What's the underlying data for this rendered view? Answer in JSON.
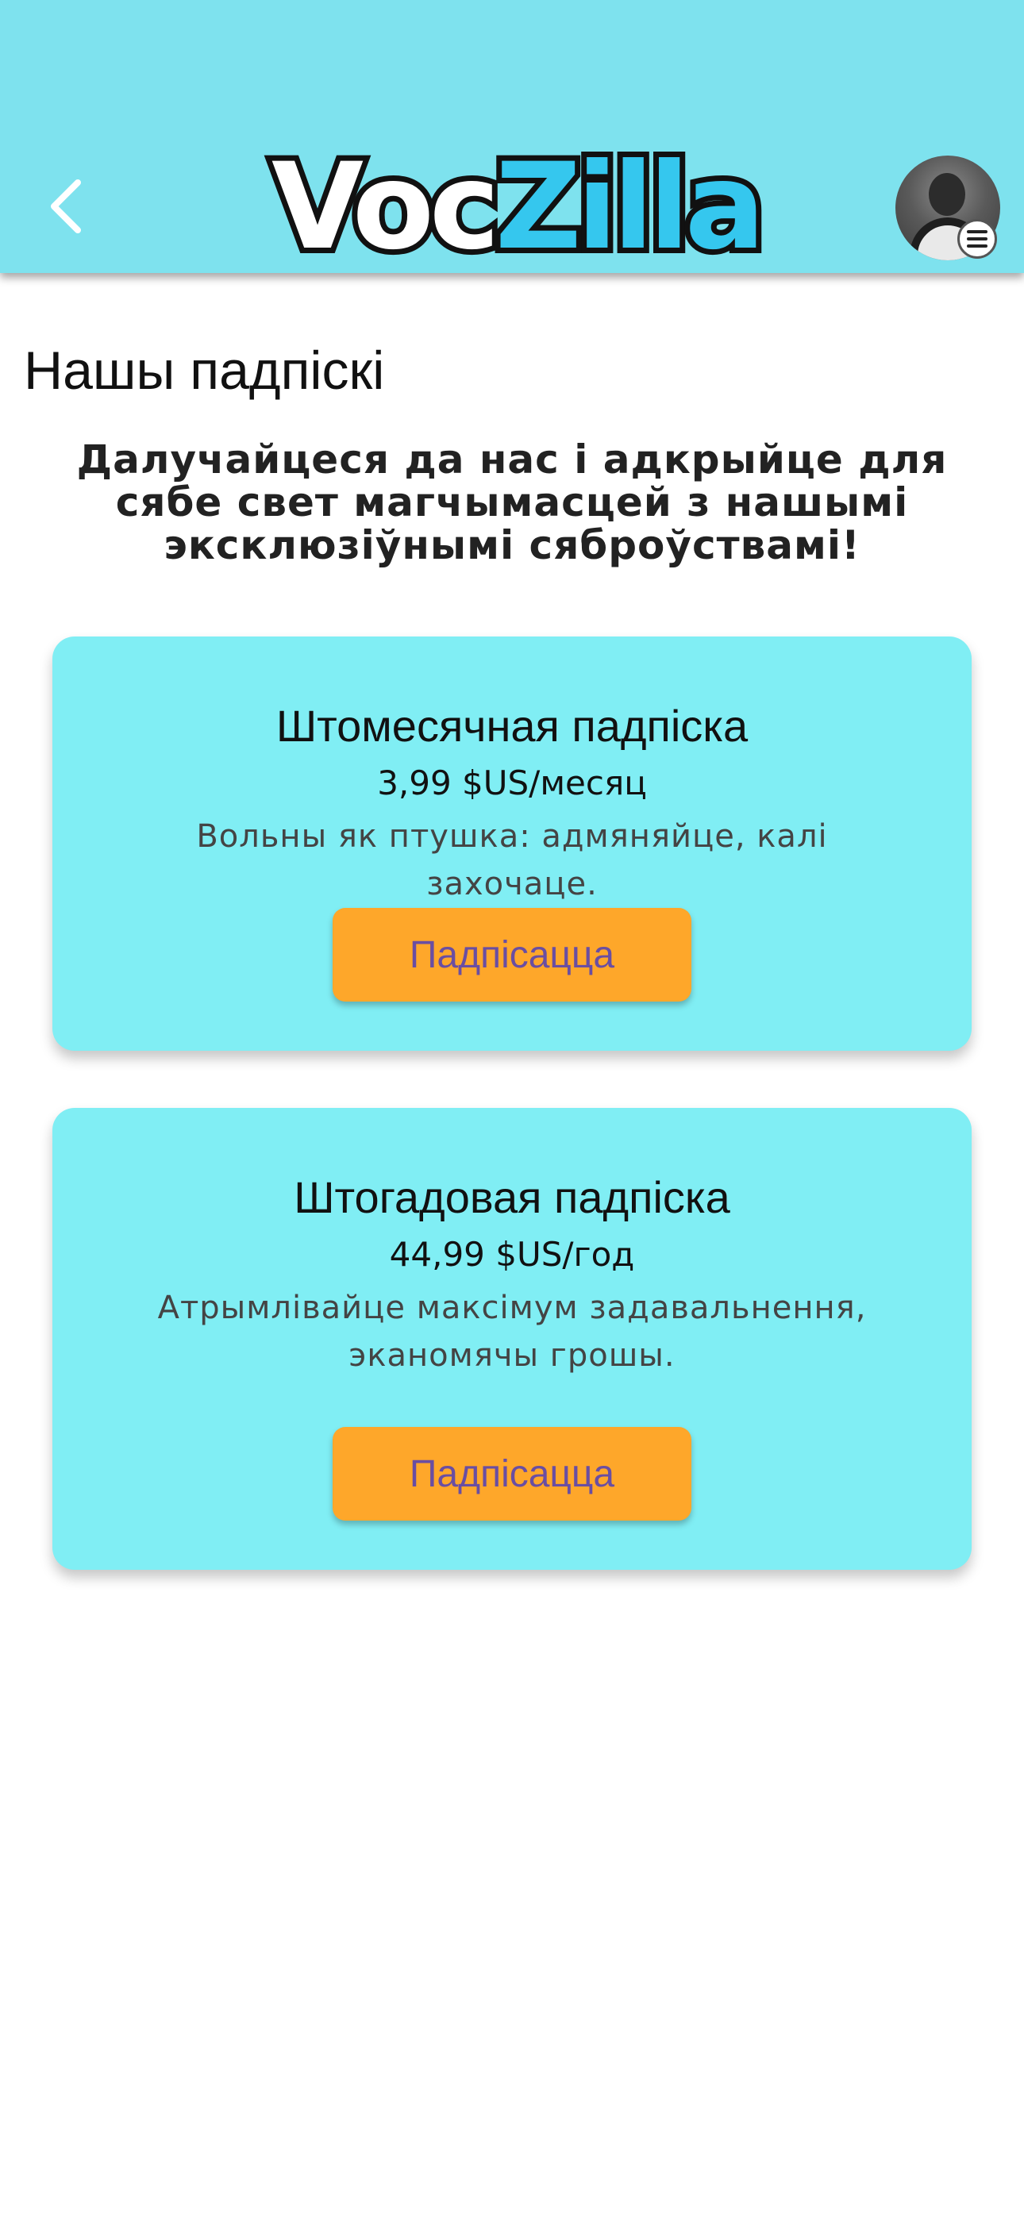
{
  "header": {
    "logo_part1": "Voc",
    "logo_part2": "Zilla",
    "colors": {
      "bar": "#7ee2ee",
      "logo_accent": "#35c7ee"
    }
  },
  "page": {
    "title": "Нашы падпіскі",
    "intro": "Далучайцеся да нас і адкрыйце для сябе свет магчымасцей з нашымі эксклюзіўнымі сяброўствамі!"
  },
  "plans": [
    {
      "title": "Штомесячная падпіска",
      "price": "3,99 $US/месяц",
      "description": "Вольны як птушка: адмяняйце, калі захочаце.",
      "button_label": "Падпісацца"
    },
    {
      "title": "Штогадовая падпіска",
      "price": "44,99 $US/год",
      "description": "Атрымлівайце максімум задавальнення, эканомячы грошы.",
      "button_label": "Падпісацца"
    }
  ],
  "icons": {
    "back": "chevron-left-icon",
    "menu": "hamburger-menu-icon",
    "avatar": "user-avatar"
  },
  "theme": {
    "card_bg": "#80eef4",
    "button_bg": "#fea72a",
    "button_text": "#6a4ea2"
  }
}
